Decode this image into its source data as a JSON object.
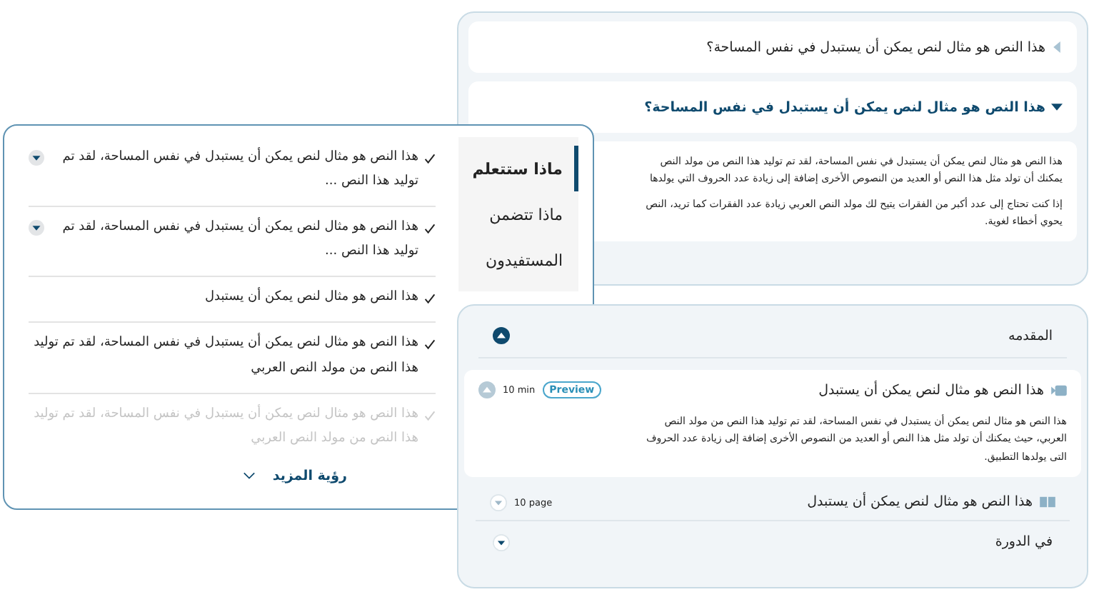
{
  "faq_card": {
    "items": [
      {
        "question": "هذا النص هو مثال لنص يمكن أن يستبدل في نفس المساحة؟",
        "expanded": false
      },
      {
        "question": "هذا النص هو مثال لنص يمكن أن يستبدل في نفس المساحة؟",
        "expanded": true,
        "answer_paragraphs": [
          [
            "هذا النص هو مثال لنص يمكن أن يستبدل في نفس المساحة، لقد تم توليد هذا النص من مولد النص",
            "يمكنك أن تولد مثل هذا النص أو العديد من النصوص الأخرى إضافة إلى زيادة عدد الحروف التي يولدها"
          ],
          [
            "إذا كنت تحتاج إلى عدد أكبر من الفقرات يتيح لك مولد النص العربي زيادة عدد الفقرات كما تريد، النص",
            "يحوي أخطاء لغوية."
          ]
        ]
      }
    ]
  },
  "learn_card": {
    "tabs": [
      {
        "label": "ماذا ستتعلم",
        "selected": true
      },
      {
        "label": "ماذا تتضمن",
        "selected": false
      },
      {
        "label": "المستفيدون",
        "selected": false
      }
    ],
    "points": [
      {
        "text": "هذا النص هو مثال لنص يمكن أن يستبدل في نفس المساحة، لقد تم توليد هذا النص ...",
        "expandable": true,
        "faded": false
      },
      {
        "text": "هذا النص هو مثال لنص يمكن أن يستبدل في نفس المساحة، لقد تم توليد هذا النص ...",
        "expandable": true,
        "faded": false
      },
      {
        "text": "هذا النص هو مثال لنص يمكن أن يستبدل",
        "expandable": false,
        "faded": false
      },
      {
        "text": "هذا النص هو مثال لنص يمكن أن يستبدل في نفس المساحة، لقد تم توليد هذا النص من مولد النص العربي",
        "expandable": false,
        "faded": false
      },
      {
        "text": "هذا النص هو مثال لنص يمكن أن يستبدل في نفس المساحة، لقد تم توليد هذا النص من مولد النص العربي",
        "expandable": false,
        "faded": true
      }
    ],
    "see_more": "رؤية المزيد"
  },
  "curriculum_card": {
    "sections": [
      {
        "title": "المقدمه",
        "expanded": true,
        "lessons": [
          {
            "kind": "video",
            "title": "هذا النص هو مثال لنص يمكن أن يستبدل",
            "duration": "10 min",
            "badge": "Preview",
            "expanded": true,
            "description": "هذا النص هو مثال لنص يمكن أن يستبدل في نفس المساحة، لقد تم توليد هذا النص من مولد النص العربي، حيث يمكنك أن تولد مثل هذا النص أو العديد من النصوص الأخرى إضافة إلى زيادة عدد الحروف التى يولدها التطبيق."
          },
          {
            "kind": "reading",
            "title": "هذا النص هو مثال لنص يمكن أن يستبدل",
            "duration": "10 page",
            "expanded": false
          }
        ]
      },
      {
        "title": "في الدورة",
        "expanded": false
      }
    ]
  }
}
